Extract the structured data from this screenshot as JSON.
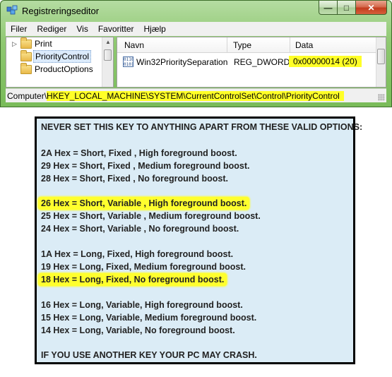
{
  "window": {
    "title": "Registreringseditor",
    "caption_buttons": {
      "minimize": "—",
      "maximize": "□",
      "close": "✕"
    }
  },
  "menu": [
    "Filer",
    "Rediger",
    "Vis",
    "Favoritter",
    "Hjælp"
  ],
  "tree": {
    "items": [
      {
        "label": "Print",
        "expander": "▷",
        "selected": false
      },
      {
        "label": "PriorityControl",
        "expander": "",
        "selected": true
      },
      {
        "label": "ProductOptions",
        "expander": "",
        "selected": false
      }
    ]
  },
  "list": {
    "columns": [
      "Navn",
      "Type",
      "Data"
    ],
    "rows": [
      {
        "name": "Win32PrioritySeparation",
        "type": "REG_DWORD",
        "data": "0x00000014 (20)"
      }
    ]
  },
  "pathbar": {
    "prefix": "Computer\\",
    "key": "HKEY_LOCAL_MACHINE\\SYSTEM\\CurrentControlSet\\Control\\PriorityControl"
  },
  "info": {
    "heading": "NEVER SET THIS KEY TO ANYTHING APART FROM THESE VALID OPTIONS:",
    "options": [
      "2A Hex = Short, Fixed , High foreground boost.",
      "29 Hex = Short, Fixed , Medium foreground boost.",
      "28 Hex = Short, Fixed , No foreground boost.",
      "26 Hex = Short, Variable , High foreground boost.",
      "25 Hex = Short, Variable , Medium foreground boost.",
      "24 Hex = Short, Variable , No foreground boost.",
      "1A Hex = Long, Fixed, High foreground boost.",
      "19 Hex = Long, Fixed, Medium foreground boost.",
      "18 Hex = Long, Fixed, No foreground boost.",
      "16 Hex = Long, Variable, High foreground boost.",
      "15 Hex = Long, Variable, Medium foreground boost.",
      "14 Hex = Long, Variable, No foreground boost."
    ],
    "highlighted": [
      3,
      8
    ],
    "warning": "IF YOU USE ANOTHER KEY YOUR PC MAY CRASH."
  },
  "colors": {
    "highlight": "#ffff27",
    "window_frame": "#8ec870",
    "info_background": "#dbecf6"
  }
}
